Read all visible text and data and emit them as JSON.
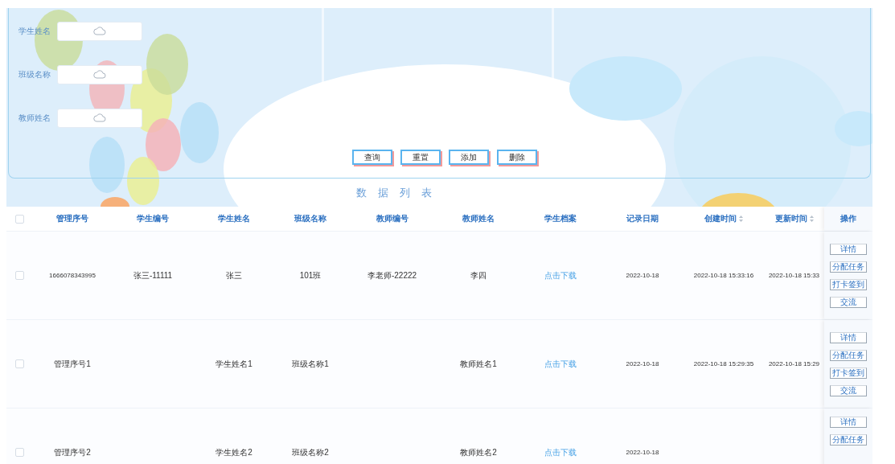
{
  "search": {
    "fields": [
      {
        "label": "学生姓名"
      },
      {
        "label": "班级名称"
      },
      {
        "label": "教师姓名"
      }
    ],
    "buttons": [
      "查询",
      "重置",
      "添加",
      "删除"
    ]
  },
  "title": "数据列表",
  "table": {
    "columns": [
      {
        "label": "管理序号",
        "sortable": false
      },
      {
        "label": "学生编号",
        "sortable": false
      },
      {
        "label": "学生姓名",
        "sortable": false
      },
      {
        "label": "班级名称",
        "sortable": false
      },
      {
        "label": "教师编号",
        "sortable": false
      },
      {
        "label": "教师姓名",
        "sortable": false
      },
      {
        "label": "学生档案",
        "sortable": false
      },
      {
        "label": "记录日期",
        "sortable": false
      },
      {
        "label": "创建时间",
        "sortable": true
      },
      {
        "label": "更新时间",
        "sortable": true
      }
    ],
    "action_column": "操作",
    "select_all": {
      "checked": false
    },
    "rows": [
      {
        "selected": false,
        "cells": [
          {
            "kind": "text",
            "text": "1666078343995"
          },
          {
            "kind": "text",
            "text": "张三-11111"
          },
          {
            "kind": "text",
            "text": "张三"
          },
          {
            "kind": "text",
            "text": "101班"
          },
          {
            "kind": "text",
            "text": "李老师-22222"
          },
          {
            "kind": "text",
            "text": "李四"
          },
          {
            "kind": "link",
            "text": "点击下载"
          },
          {
            "kind": "text",
            "text": "2022-10-18"
          },
          {
            "kind": "text",
            "text": "2022-10-18 15:33:16"
          },
          {
            "kind": "text",
            "text": "2022-10-18 15:33"
          }
        ],
        "actions": [
          "详情",
          "分配任务",
          "打卡签到",
          "交流"
        ]
      },
      {
        "selected": false,
        "cells": [
          {
            "kind": "text",
            "text": "管理序号1"
          },
          null,
          {
            "kind": "text",
            "text": "学生姓名1"
          },
          {
            "kind": "text",
            "text": "班级名称1"
          },
          null,
          {
            "kind": "text",
            "text": "教师姓名1"
          },
          {
            "kind": "link",
            "text": "点击下载"
          },
          {
            "kind": "text",
            "text": "2022-10-18"
          },
          {
            "kind": "text",
            "text": "2022-10-18 15:29:35"
          },
          {
            "kind": "text",
            "text": "2022-10-18 15:29"
          }
        ],
        "actions": [
          "详情",
          "分配任务",
          "打卡签到",
          "交流"
        ]
      },
      {
        "selected": false,
        "cells": [
          {
            "kind": "text",
            "text": "管理序号2"
          },
          null,
          {
            "kind": "text",
            "text": "学生姓名2"
          },
          {
            "kind": "text",
            "text": "班级名称2"
          },
          null,
          {
            "kind": "text",
            "text": "教师姓名2"
          },
          {
            "kind": "link",
            "text": "点击下载"
          },
          {
            "kind": "text",
            "text": "2022-10-18"
          },
          null,
          null
        ],
        "actions": [
          "详情",
          "分配任务"
        ]
      }
    ]
  }
}
